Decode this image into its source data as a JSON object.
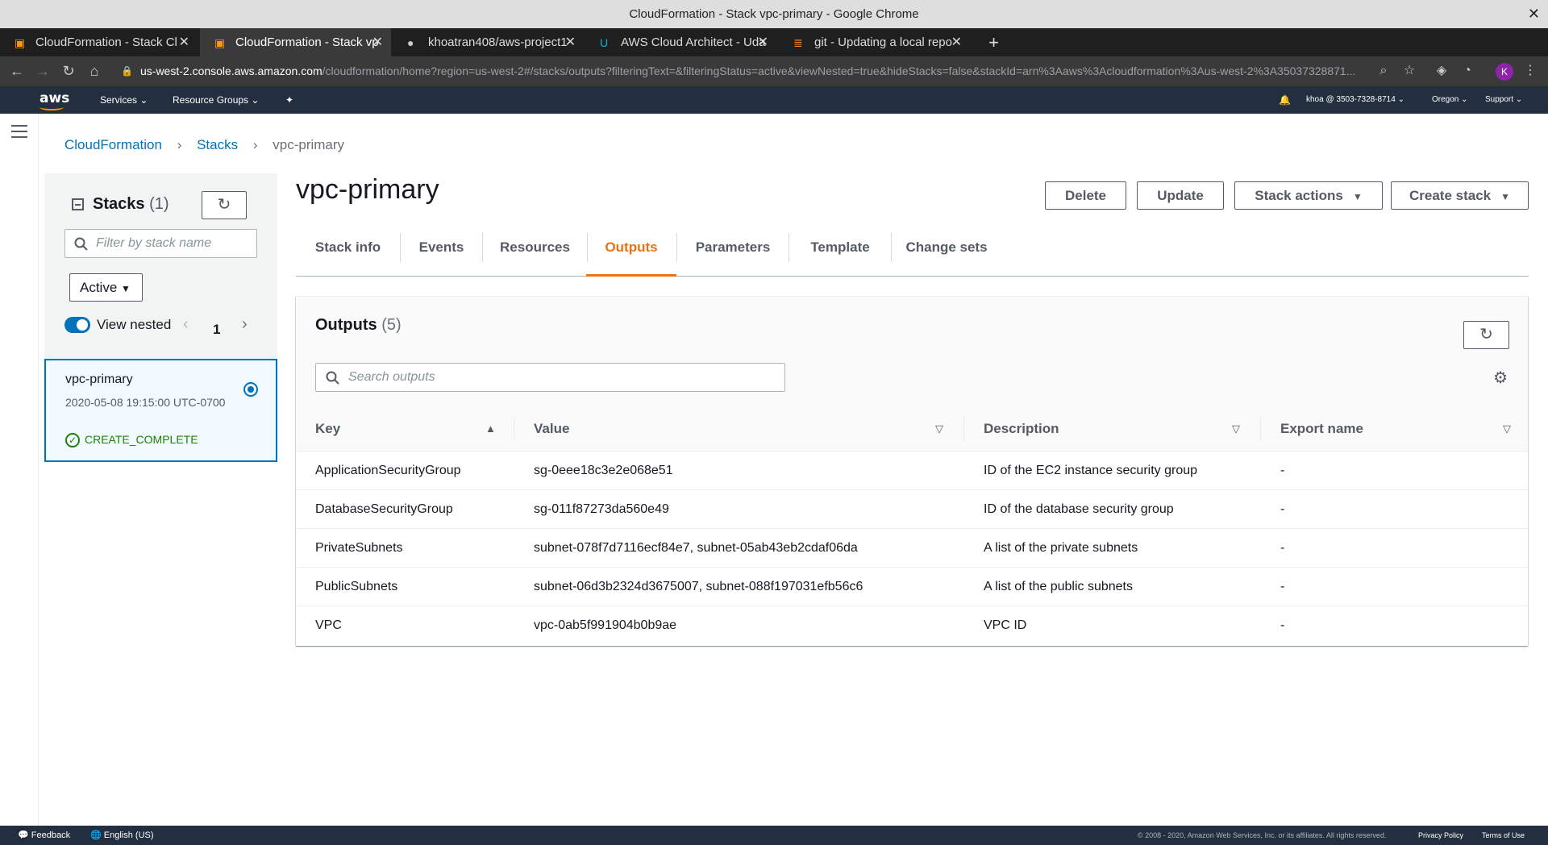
{
  "window": {
    "title": "CloudFormation - Stack vpc-primary - Google Chrome"
  },
  "browser": {
    "tabs": [
      {
        "label": "CloudFormation - Stack Cl",
        "active": false
      },
      {
        "label": "CloudFormation - Stack vp",
        "active": true
      },
      {
        "label": "khoatran408/aws-project1",
        "active": false
      },
      {
        "label": "AWS Cloud Architect - Uda",
        "active": false
      },
      {
        "label": "git - Updating a local repo",
        "active": false
      }
    ],
    "url_host": "us-west-2.console.aws.amazon.com",
    "url_path": "/cloudformation/home?region=us-west-2#/stacks/outputs?filteringText=&filteringStatus=active&viewNested=true&hideStacks=false&stackId=arn%3Aaws%3Acloudformation%3Aus-west-2%3A35037328871...",
    "avatar_letter": "K"
  },
  "awsnav": {
    "logo": "aws",
    "services": "Services",
    "resource_groups": "Resource Groups",
    "account": "khoa @ 3503-7328-8714",
    "region": "Oregon",
    "support": "Support"
  },
  "breadcrumb": {
    "root": "CloudFormation",
    "stacks": "Stacks",
    "current": "vpc-primary"
  },
  "sidepanel": {
    "title": "Stacks",
    "count": "(1)",
    "filter_placeholder": "Filter by stack name",
    "status_filter": "Active",
    "view_nested": "View nested",
    "page": "1",
    "stack": {
      "name": "vpc-primary",
      "date": "2020-05-08 19:15:00 UTC-0700",
      "status": "CREATE_COMPLETE"
    }
  },
  "main": {
    "title": "vpc-primary",
    "buttons": {
      "delete": "Delete",
      "update": "Update",
      "stack_actions": "Stack actions",
      "create_stack": "Create stack"
    },
    "tabs": [
      "Stack info",
      "Events",
      "Resources",
      "Outputs",
      "Parameters",
      "Template",
      "Change sets"
    ],
    "active_tab": "Outputs"
  },
  "outputs": {
    "title": "Outputs",
    "count": "(5)",
    "search_placeholder": "Search outputs",
    "columns": [
      "Key",
      "Value",
      "Description",
      "Export name"
    ],
    "rows": [
      {
        "key": "ApplicationSecurityGroup",
        "value": "sg-0eee18c3e2e068e51",
        "description": "ID of the EC2 instance security group",
        "export": "-"
      },
      {
        "key": "DatabaseSecurityGroup",
        "value": "sg-011f87273da560e49",
        "description": "ID of the database security group",
        "export": "-"
      },
      {
        "key": "PrivateSubnets",
        "value": "subnet-078f7d7116ecf84e7, subnet-05ab43eb2cdaf06da",
        "description": "A list of the private subnets",
        "export": "-"
      },
      {
        "key": "PublicSubnets",
        "value": "subnet-06d3b2324d3675007, subnet-088f197031efb56c6",
        "description": "A list of the public subnets",
        "export": "-"
      },
      {
        "key": "VPC",
        "value": "vpc-0ab5f991904b0b9ae",
        "description": "VPC ID",
        "export": "-"
      }
    ]
  },
  "footer": {
    "feedback": "Feedback",
    "language": "English (US)",
    "copyright": "© 2008 - 2020, Amazon Web Services, Inc. or its affiliates. All rights reserved.",
    "privacy": "Privacy Policy",
    "terms": "Terms of Use"
  },
  "colors": {
    "aws_nav": "#232f3e",
    "link": "#0073bb",
    "accent": "#ec7211",
    "success": "#1d8102"
  }
}
